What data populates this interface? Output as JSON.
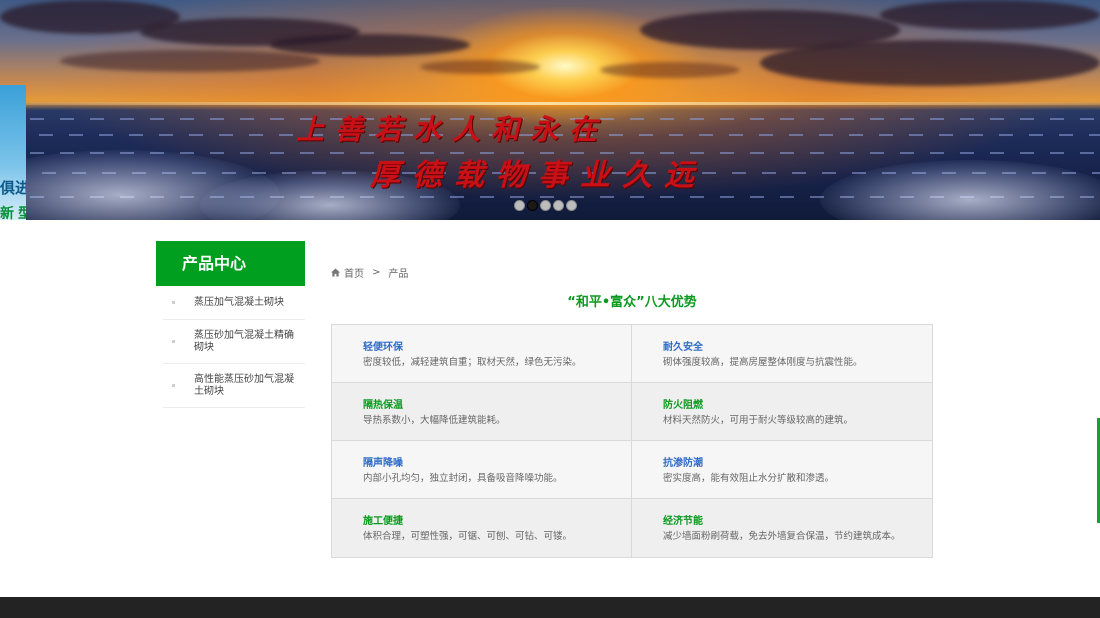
{
  "banner": {
    "slogan_line1": "上善若水人和永在",
    "slogan_line2": "厚德载物事业久远",
    "slide_count": 5,
    "active_slide": 2
  },
  "left_ad": {
    "text1": "俱进",
    "text2": "新型"
  },
  "sidebar": {
    "title": "产品中心",
    "items": [
      {
        "label": "蒸压加气混凝土砌块"
      },
      {
        "label": "蒸压砂加气混凝土精确砌块"
      },
      {
        "label": "高性能蒸压砂加气混凝土砌块"
      }
    ]
  },
  "breadcrumb": {
    "home": "首页",
    "separator": ">",
    "current": "产品"
  },
  "section": {
    "title": "“和平•富众”八大优势",
    "features": [
      {
        "title": "轻便环保",
        "desc": "密度较低，减轻建筑自重；取材天然，绿色无污染。",
        "color": "#2f6bc6"
      },
      {
        "title": "耐久安全",
        "desc": "砌体强度较高，提高房屋整体刚度与抗震性能。",
        "color": "#2f6bc6"
      },
      {
        "title": "隔热保温",
        "desc": "导热系数小，大幅降低建筑能耗。",
        "color": "#0a9a1e"
      },
      {
        "title": "防火阻燃",
        "desc": "材料天然防火，可用于耐火等级较高的建筑。",
        "color": "#0a9a1e"
      },
      {
        "title": "隔声降噪",
        "desc": "内部小孔均匀，独立封闭，具备吸音降噪功能。",
        "color": "#2f6bc6"
      },
      {
        "title": "抗渗防潮",
        "desc": "密实度高，能有效阻止水分扩散和渗透。",
        "color": "#2f6bc6"
      },
      {
        "title": "施工便捷",
        "desc": "体积合理，可塑性强，可锯、可刨、可钻、可镂。",
        "color": "#0a9a1e"
      },
      {
        "title": "经济节能",
        "desc": "减少墙面粉刷荷载，免去外墙复合保温，节约建筑成本。",
        "color": "#0a9a1e"
      }
    ]
  },
  "colors": {
    "brand_green": "#009f1f",
    "feature_blue": "#2f6bc6",
    "footer": "#232323"
  }
}
